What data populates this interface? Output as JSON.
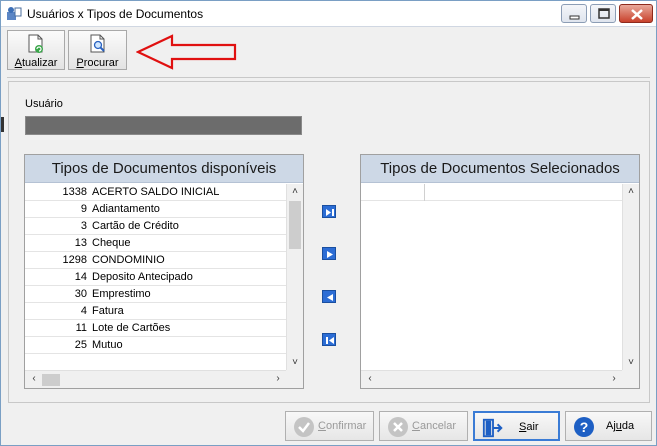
{
  "window": {
    "title": "Usuários x Tipos de Documentos",
    "icon": "users-docs-icon"
  },
  "toolbar": {
    "atualizar": {
      "label_u": "A",
      "label_rest": "tualizar",
      "icon": "refresh-document-icon"
    },
    "procurar": {
      "label_u": "P",
      "label_rest": "rocurar",
      "icon": "search-document-icon"
    },
    "annotation": "red-arrow-icon"
  },
  "usuario": {
    "label": "Usuário",
    "value": ""
  },
  "available": {
    "header": "Tipos de Documentos disponíveis",
    "rows": [
      {
        "code": "1338",
        "desc": "ACERTO SALDO INICIAL"
      },
      {
        "code": "9",
        "desc": "Adiantamento"
      },
      {
        "code": "3",
        "desc": "Cartão de Crédito"
      },
      {
        "code": "13",
        "desc": "Cheque"
      },
      {
        "code": "1298",
        "desc": "CONDOMINIO"
      },
      {
        "code": "14",
        "desc": "Deposito Antecipado"
      },
      {
        "code": "30",
        "desc": "Emprestimo"
      },
      {
        "code": "4",
        "desc": "Fatura"
      },
      {
        "code": "11",
        "desc": "Lote de Cartões"
      },
      {
        "code": "25",
        "desc": "Mutuo"
      }
    ]
  },
  "selected": {
    "header": "Tipos de Documentos Selecionados",
    "rows": []
  },
  "transfer_buttons": [
    "move-all-right-icon",
    "move-right-icon",
    "move-left-icon",
    "move-all-left-icon"
  ],
  "buttons": {
    "confirmar": {
      "label_u": "C",
      "label_rest": "onfirmar",
      "enabled": false,
      "icon": "check-circle-icon"
    },
    "cancelar": {
      "label_u": "C",
      "label_rest": "ancelar",
      "enabled": false,
      "icon": "x-circle-icon"
    },
    "sair": {
      "label_u": "S",
      "label_rest": "air",
      "enabled": true,
      "icon": "exit-door-icon"
    },
    "ajuda": {
      "label_prefix": "Aj",
      "label_u": "u",
      "label_rest": "da",
      "enabled": true,
      "icon": "help-icon"
    }
  },
  "colors": {
    "header_bg": "#cdd8e6",
    "accent_blue": "#2c6dd5",
    "arrow_red": "#e01010",
    "field_dark": "#6c6c6c"
  }
}
